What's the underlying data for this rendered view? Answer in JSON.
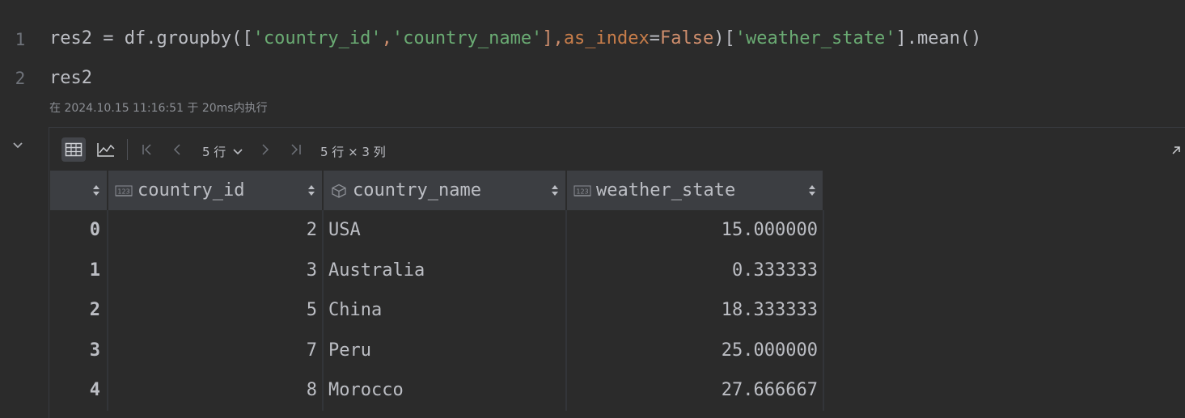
{
  "editor": {
    "line_numbers": [
      "1",
      "2"
    ],
    "line1": {
      "p1": "res2 = df.groupby([",
      "s1": "'country_id'",
      "p2": ",",
      "s2": "'country_name'",
      "p3": "],",
      "param": "as_index",
      "p4": "=",
      "kw": "False",
      "p5": ")[",
      "s3": "'weather_state'",
      "p6": "].mean()"
    },
    "line2": "res2",
    "exec_info": "在 2024.10.15 11:16:51 于 20ms内执行"
  },
  "toolbar": {
    "rows_label": "5 行",
    "shape_label": "5 行 × 3 列"
  },
  "table": {
    "columns": [
      {
        "name": "country_id",
        "type_icon": "numeric-123-icon"
      },
      {
        "name": "country_name",
        "type_icon": "object-cube-icon"
      },
      {
        "name": "weather_state",
        "type_icon": "numeric-123-icon"
      }
    ],
    "rows": [
      {
        "index": "0",
        "country_id": "2",
        "country_name": "USA",
        "weather_state": "15.000000"
      },
      {
        "index": "1",
        "country_id": "3",
        "country_name": "Australia",
        "weather_state": "0.333333"
      },
      {
        "index": "2",
        "country_id": "5",
        "country_name": "China",
        "weather_state": "18.333333"
      },
      {
        "index": "3",
        "country_id": "7",
        "country_name": "Peru",
        "weather_state": "25.000000"
      },
      {
        "index": "4",
        "country_id": "8",
        "country_name": "Morocco",
        "weather_state": "27.666667"
      }
    ]
  }
}
